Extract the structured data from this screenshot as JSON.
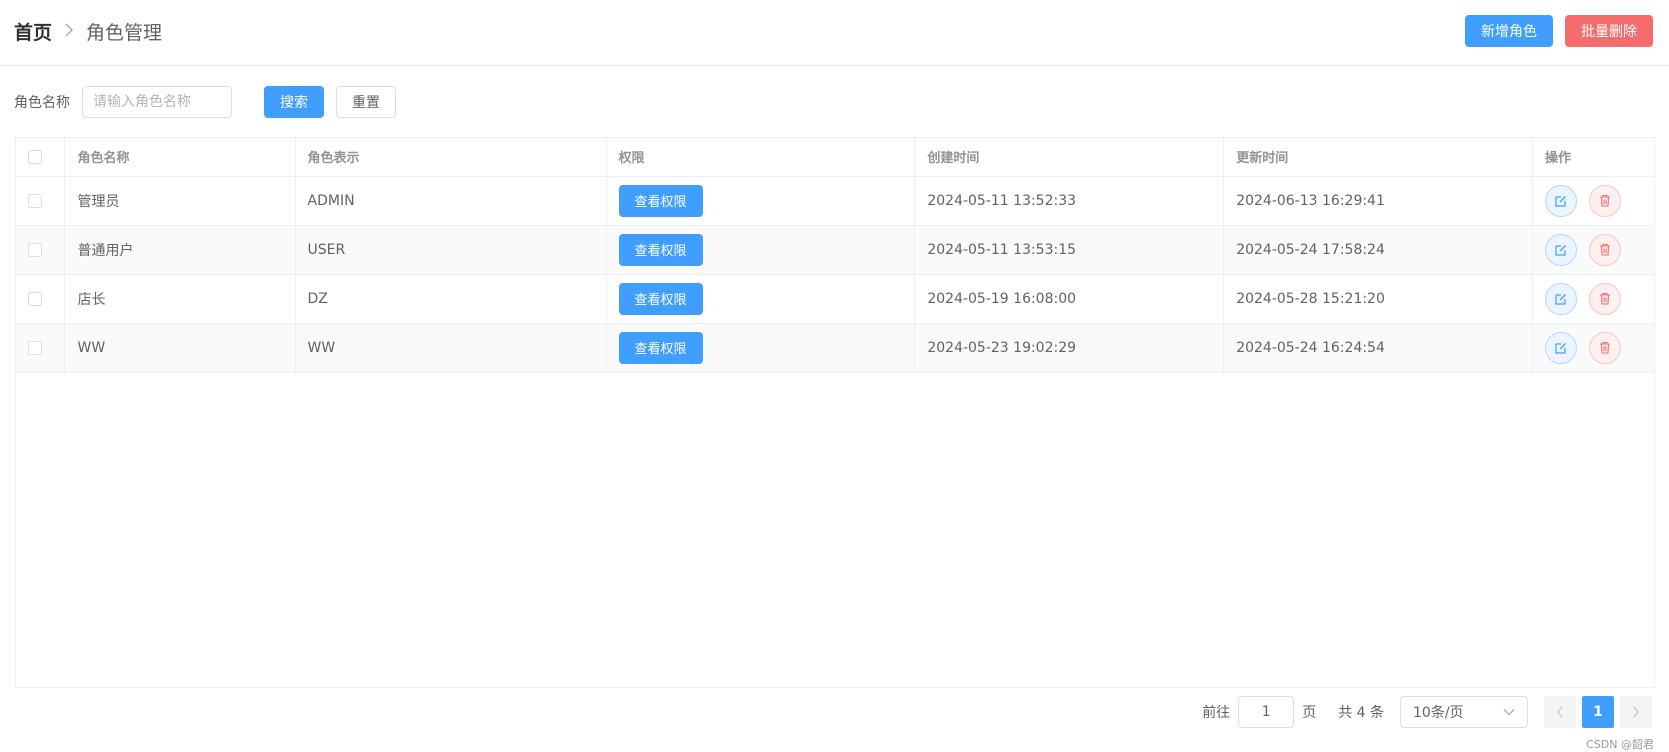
{
  "breadcrumb": {
    "home": "首页",
    "current": "角色管理"
  },
  "header_actions": {
    "add_label": "新增角色",
    "batch_delete_label": "批量删除"
  },
  "search": {
    "label": "角色名称",
    "placeholder": "请输入角色名称",
    "search_label": "搜索",
    "reset_label": "重置"
  },
  "table": {
    "columns": [
      "角色名称",
      "角色表示",
      "权限",
      "创建时间",
      "更新时间",
      "操作"
    ],
    "perm_button_label": "查看权限",
    "rows": [
      {
        "name": "管理员",
        "code": "ADMIN",
        "created": "2024-05-11 13:52:33",
        "updated": "2024-06-13 16:29:41"
      },
      {
        "name": "普通用户",
        "code": "USER",
        "created": "2024-05-11 13:53:15",
        "updated": "2024-05-24 17:58:24"
      },
      {
        "name": "店长",
        "code": "DZ",
        "created": "2024-05-19 16:08:00",
        "updated": "2024-05-28 15:21:20"
      },
      {
        "name": "WW",
        "code": "WW",
        "created": "2024-05-23 19:02:29",
        "updated": "2024-05-24 16:24:54"
      }
    ]
  },
  "pagination": {
    "goto_prefix": "前往",
    "goto_value": "1",
    "goto_suffix": "页",
    "total_text": "共 4 条",
    "page_size": "10条/页",
    "current_page": "1"
  },
  "watermark": "CSDN @韶君",
  "icons": [
    "chevron-right-icon",
    "edit-icon",
    "delete-icon",
    "chevron-down-icon",
    "chevron-left-icon"
  ],
  "colors": {
    "primary": "#409eff",
    "danger": "#f56c6c"
  }
}
